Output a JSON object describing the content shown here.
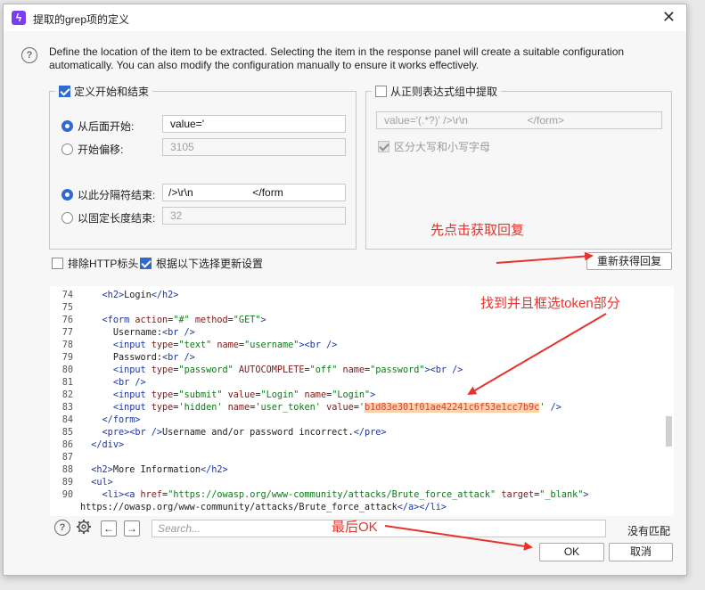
{
  "window": {
    "title": "提取的grep项的定义",
    "close_glyph": "✕"
  },
  "description": "Define the location of the item to be extracted. Selecting the item in the response panel will create a suitable configuration automatically. You can also modify the configuration manually to ensure it works effectively.",
  "start_end_group": {
    "title": "定义开始和结束",
    "checked": true,
    "start_after": {
      "label": "从后面开始:",
      "value": "value='",
      "selected": true
    },
    "start_offset": {
      "label": "开始偏移:",
      "value": "3105",
      "selected": false
    },
    "end_delimiter": {
      "label": "以此分隔符结束:",
      "value": "/>\\r\\n                    </form",
      "selected": true
    },
    "fixed_length": {
      "label": "以固定长度结束:",
      "value": "32",
      "selected": false
    }
  },
  "regex_group": {
    "title": "从正则表达式组中提取",
    "checked": false,
    "regex_value": "value='(.*?)' />\\r\\n                    </form>",
    "case_sensitive_label": "区分大写和小写字母",
    "case_sensitive_checked": true
  },
  "annotations": {
    "click_fetch": "先点击获取回复",
    "find_token": "找到并且框选token部分",
    "finally_ok": "最后OK"
  },
  "options": {
    "exclude_http_headers": {
      "label": "排除HTTP标头",
      "checked": false
    },
    "update_config": {
      "label": "根据以下选择更新设置",
      "checked": true
    }
  },
  "refetch_button": "重新获得回复",
  "code_lines": [
    {
      "n": "74",
      "indent": "    ",
      "parts": [
        [
          "tg",
          "<h2>"
        ],
        [
          "",
          "Login"
        ],
        [
          "tg",
          "</h2>"
        ]
      ]
    },
    {
      "n": "75",
      "indent": "",
      "parts": []
    },
    {
      "n": "76",
      "indent": "    ",
      "parts": [
        [
          "tg",
          "<form "
        ],
        [
          "at",
          "action"
        ],
        [
          "",
          "="
        ],
        [
          "st",
          "\"#\""
        ],
        [
          "at",
          " method"
        ],
        [
          "",
          "="
        ],
        [
          "st",
          "\"GET\""
        ],
        [
          "tg",
          ">"
        ]
      ]
    },
    {
      "n": "77",
      "indent": "      ",
      "parts": [
        [
          "",
          "Username:"
        ],
        [
          "tg",
          "<br />"
        ]
      ]
    },
    {
      "n": "78",
      "indent": "      ",
      "parts": [
        [
          "tg",
          "<input "
        ],
        [
          "at",
          "type"
        ],
        [
          "",
          "="
        ],
        [
          "st",
          "\"text\""
        ],
        [
          "at",
          " name"
        ],
        [
          "",
          "="
        ],
        [
          "st",
          "\"username\""
        ],
        [
          "tg",
          ">"
        ],
        [
          "tg",
          "<br />"
        ]
      ]
    },
    {
      "n": "79",
      "indent": "      ",
      "parts": [
        [
          "",
          "Password:"
        ],
        [
          "tg",
          "<br />"
        ]
      ]
    },
    {
      "n": "80",
      "indent": "      ",
      "parts": [
        [
          "tg",
          "<input "
        ],
        [
          "at",
          "type"
        ],
        [
          "",
          "="
        ],
        [
          "st",
          "\"password\""
        ],
        [
          "at",
          " AUTOCOMPLETE"
        ],
        [
          "",
          "="
        ],
        [
          "st",
          "\"off\""
        ],
        [
          "at",
          " name"
        ],
        [
          "",
          "="
        ],
        [
          "st",
          "\"password\""
        ],
        [
          "tg",
          ">"
        ],
        [
          "tg",
          "<br />"
        ]
      ]
    },
    {
      "n": "81",
      "indent": "      ",
      "parts": [
        [
          "tg",
          "<br />"
        ]
      ]
    },
    {
      "n": "82",
      "indent": "      ",
      "parts": [
        [
          "tg",
          "<input "
        ],
        [
          "at",
          "type"
        ],
        [
          "",
          "="
        ],
        [
          "st",
          "\"submit\""
        ],
        [
          "at",
          " value"
        ],
        [
          "",
          "="
        ],
        [
          "st",
          "\"Login\""
        ],
        [
          "at",
          " name"
        ],
        [
          "",
          "="
        ],
        [
          "st",
          "\"Login\""
        ],
        [
          "tg",
          ">"
        ]
      ]
    },
    {
      "n": "83",
      "indent": "      ",
      "parts": [
        [
          "tg",
          "<input "
        ],
        [
          "at",
          "type"
        ],
        [
          "",
          "="
        ],
        [
          "st",
          "'hidden'"
        ],
        [
          "at",
          " name"
        ],
        [
          "",
          "="
        ],
        [
          "st",
          "'user_token'"
        ],
        [
          "at",
          " value"
        ],
        [
          "",
          "="
        ],
        [
          "st",
          "'"
        ],
        [
          "hl",
          "b1d83e301f01ae42241c6f53e1cc7b9c"
        ],
        [
          "st",
          "'"
        ],
        [
          "tg",
          " />"
        ]
      ]
    },
    {
      "n": "84",
      "indent": "    ",
      "parts": [
        [
          "tg",
          "</form>"
        ]
      ]
    },
    {
      "n": "85",
      "indent": "    ",
      "parts": [
        [
          "tg",
          "<pre>"
        ],
        [
          "tg",
          "<br />"
        ],
        [
          "",
          "Username and/or password incorrect."
        ],
        [
          "tg",
          "</pre>"
        ]
      ]
    },
    {
      "n": "86",
      "indent": "  ",
      "parts": [
        [
          "tg",
          "</div>"
        ]
      ]
    },
    {
      "n": "87",
      "indent": "",
      "parts": []
    },
    {
      "n": "88",
      "indent": "  ",
      "parts": [
        [
          "tg",
          "<h2>"
        ],
        [
          "",
          "More Information"
        ],
        [
          "tg",
          "</h2>"
        ]
      ]
    },
    {
      "n": "89",
      "indent": "  ",
      "parts": [
        [
          "tg",
          "<ul>"
        ]
      ]
    },
    {
      "n": "90",
      "indent": "    ",
      "parts": [
        [
          "tg",
          "<li>"
        ],
        [
          "tg",
          "<a "
        ],
        [
          "at",
          "href"
        ],
        [
          "",
          "="
        ],
        [
          "st",
          "\"https://owasp.org/www-community/attacks/Brute_force_attack\""
        ],
        [
          "at",
          " target"
        ],
        [
          "",
          "="
        ],
        [
          "st",
          "\"_blank\""
        ],
        [
          "tg",
          ">"
        ]
      ]
    },
    {
      "n": "",
      "indent": "",
      "parts": [
        [
          "",
          "https://owasp.org/www-community/attacks/Brute_force_attack"
        ],
        [
          "tg",
          "</a>"
        ],
        [
          "tg",
          "</li>"
        ]
      ]
    }
  ],
  "search": {
    "placeholder": "Search..."
  },
  "no_match": "没有匹配",
  "ok_button": "OK",
  "cancel_button": "取消",
  "annotation_color": "#e8322c",
  "accent_color": "#2f6ad0"
}
